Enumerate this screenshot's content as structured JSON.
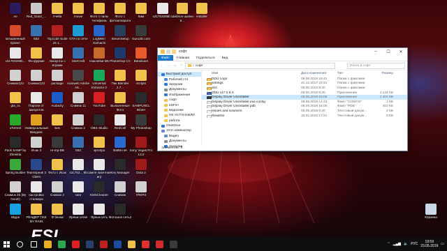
{
  "desktop_icons": [
    {
      "label": "Ae",
      "color": "#2b1a5c"
    },
    {
      "label": "Red_Giant_...",
      "color": "#c8c8c8"
    },
    {
      "label": "Учеба",
      "color": "#f0c24b"
    },
    {
      "label": "movie",
      "color": "#f0c24b"
    },
    {
      "label": "Фото с папы телефона",
      "color": "#f0c24b"
    },
    {
      "label": "Фото с фотоаппарата",
      "color": "#f0c24b"
    },
    {
      "label": "Ким",
      "color": "#f0c24b"
    },
    {
      "label": "x31753285b...",
      "color": "#e8e8e8"
    },
    {
      "label": "Шаблон шапки в...",
      "color": "#f0c24b"
    },
    {
      "label": "installer",
      "color": "#f0c24b"
    },
    {
      "label": "Безымянный проект",
      "color": "#d84a2a"
    },
    {
      "label": "553",
      "color": "#3a6fb0"
    },
    {
      "label": "Topcode Suite 15.1...",
      "color": "#b42020"
    },
    {
      "label": "GTA по сети",
      "color": "#1f9ad6"
    },
    {
      "label": "LogMeIn Hamachi",
      "color": "#2566c8"
    },
    {
      "label": "SteamSetup",
      "color": "#2a3f5c"
    },
    {
      "label": "Guru3D.com",
      "color": "#3a3a3a"
    },
    {
      "label": "x31753286b...",
      "color": "#e8e8e8"
    },
    {
      "label": "Фо-фуркие",
      "color": "#f0c24b"
    },
    {
      "label": "Аккаунты с играми",
      "color": "#e8e8e8"
    },
    {
      "label": "StarCraft",
      "color": "#3a6fb0"
    },
    {
      "label": "Наклейки Ms",
      "color": "#c86a2a"
    },
    {
      "label": "Photoshop CC",
      "color": "#1c3b6b"
    },
    {
      "label": "Bandicam",
      "color": "#e85a2a"
    },
    {
      "label": "Снимок123",
      "color": "#d0d0d0"
    },
    {
      "label": "Снимок123",
      "color": "#d0d0d0"
    },
    {
      "label": "package",
      "color": "#d0d0d0"
    },
    {
      "label": "Autoweb Adobe AE...",
      "color": "#4a4a4a"
    },
    {
      "label": "Universal Extractor 2",
      "color": "#1aa85a"
    },
    {
      "label": "Пак Blender 2.7...",
      "color": "#f0c24b"
    },
    {
      "label": "Scripts",
      "color": "#f0c24b"
    },
    {
      "label": "gta_ra",
      "color": "#f0c24b"
    },
    {
      "label": "Пароли от аккаунтов",
      "color": "#e8e8e8"
    },
    {
      "label": "Audacity",
      "color": "#1c5cc8"
    },
    {
      "label": "Снимок 11",
      "color": "#d0d0d0"
    },
    {
      "label": "YouTube",
      "color": "#d82020"
    },
    {
      "label": "Выпаленные Фото",
      "color": "#f0c24b"
    },
    {
      "label": "SAMPUNCL 5Dver",
      "color": "#2a2a2a"
    },
    {
      "label": "uTorrent",
      "color": "#2aa82a"
    },
    {
      "label": "Универсальный Виндовс",
      "color": "#e0a020"
    },
    {
      "label": "Бек",
      "color": "#f0c24b"
    },
    {
      "label": "Снимок 2",
      "color": "#d0d0d0"
    },
    {
      "label": "OBS Studio",
      "color": "#2a2a2a"
    },
    {
      "label": "RedCell",
      "color": "#e8e8e8"
    },
    {
      "label": "My Photoshop",
      "color": "#3a3a3a"
    },
    {
      "label": "Pack SAMP by Zheekla",
      "color": "#2a2a2a"
    },
    {
      "label": "Исак 3",
      "color": "#d0d0d0"
    },
    {
      "label": "re-mp-BB",
      "color": "#3a3a3a"
    },
    {
      "label": "553",
      "color": "#3a6fb0"
    },
    {
      "label": "эргопро",
      "color": "#f0c24b"
    },
    {
      "label": "Battle.net",
      "color": "#2a6ad0"
    },
    {
      "label": "Sony Vegas Pro 13.0",
      "color": "#a01a1a"
    },
    {
      "label": "Spring Builder",
      "color": "#3aa83a"
    },
    {
      "label": "TeamSpeak 3 Client",
      "color": "#2a4a8a"
    },
    {
      "label": "Фото с Исак",
      "color": "#f0c24b"
    },
    {
      "label": "x31753... 9b",
      "color": "#e8e8e8"
    },
    {
      "label": "сампе пакетная игр",
      "color": "#e8e8e8"
    },
    {
      "label": "Key Manager",
      "color": "#2a2a2a"
    },
    {
      "label": "Dota 2",
      "color": "#a01a1a"
    },
    {
      "label": "Снимок 25 (By GooD)",
      "color": "#d0d0d0"
    },
    {
      "label": "настройки сталкера",
      "color": "#e8e8e8"
    },
    {
      "label": "Снимок 2",
      "color": "#d0d0d0"
    },
    {
      "label": "sara",
      "color": "#e8e8e8"
    },
    {
      "label": "KMSCleaner",
      "color": "#2a2a2a"
    },
    {
      "label": "Снимок",
      "color": "#d0d0d0"
    },
    {
      "label": "!ПК!РЗ",
      "color": "#d0d0d0"
    },
    {
      "label": "Skype",
      "color": "#1aa0e0"
    },
    {
      "label": "РЕНДЕР ПАК BY RAIN",
      "color": "#f0c24b"
    },
    {
      "label": "Ф блоки",
      "color": "#f0c24b"
    },
    {
      "label": "Ярлык сетке",
      "color": "#e8e8e8"
    },
    {
      "label": "Ярлык сеть",
      "color": "#e8e8e8"
    },
    {
      "label": "Фотошоп сеть2",
      "color": "#2a2a2a"
    },
    {
      "label": "Корзина",
      "color": "#c8d8e8"
    }
  ],
  "explorer": {
    "title": "софт",
    "ribbon_tabs": {
      "file": "Файл",
      "home": "Главная",
      "share": "Поделиться",
      "view": "Вид"
    },
    "address_arrow": "›",
    "address": "софт",
    "search_placeholder": "Поиск в софт",
    "nav": [
      {
        "label": "Быстрый доступ",
        "sub": false,
        "sel": true,
        "color": "#2f7bd6"
      },
      {
        "label": "Рабочий сто",
        "sub": true,
        "sel": false,
        "color": "#4a8ad0"
      },
      {
        "label": "Загрузки",
        "sub": true,
        "sel": false,
        "color": "#2f7bd6"
      },
      {
        "label": "Документы",
        "sub": true,
        "sel": false,
        "color": "#8a8a8a"
      },
      {
        "label": "Изображения",
        "sub": true,
        "sel": false,
        "color": "#3a7ac8"
      },
      {
        "label": "софт",
        "sub": true,
        "sel": false,
        "color": "#f0c24b"
      },
      {
        "label": "eSFX+",
        "sub": true,
        "sel": false,
        "color": "#f0c24b"
      },
      {
        "label": "видосики",
        "sub": true,
        "sel": false,
        "color": "#f0c24b"
      },
      {
        "label": "НЕ УСТАНАВЛИ",
        "sub": true,
        "sel": false,
        "color": "#f0c24b"
      },
      {
        "label": "работа",
        "sub": true,
        "sel": false,
        "color": "#f0c24b"
      },
      {
        "label": "OneDrive",
        "sub": false,
        "sel": false,
        "color": "#2f7bd6"
      },
      {
        "label": "Этот компьютер",
        "sub": false,
        "sel": false,
        "color": "#5a8ac8"
      },
      {
        "label": "Видео",
        "sub": true,
        "sel": false,
        "color": "#5a8ac8"
      },
      {
        "label": "Документы",
        "sub": true,
        "sel": false,
        "color": "#8a8a8a"
      },
      {
        "label": "Загрузки",
        "sub": true,
        "sel": false,
        "color": "#2f7bd6"
      }
    ],
    "columns": {
      "name": "Имя",
      "date": "Дата изменения",
      "type": "Тип",
      "size": "Размер"
    },
    "files": [
      {
        "name": "DDU Logs",
        "date": "05.06.2019 18:41",
        "type": "Папка с файлами",
        "size": "",
        "color": "#f0c24b",
        "sel": false
      },
      {
        "name": "settings",
        "date": "21.12.2017 23:41",
        "type": "Папка с файлами",
        "size": "",
        "color": "#f0c24b",
        "sel": false
      },
      {
        "name": "x64",
        "date": "05.05.2019 8:20",
        "type": "Папка с файлами",
        "size": "",
        "color": "#f0c24b",
        "sel": false
      },
      {
        "name": "DDU v17.0.6.4",
        "date": "05.05.2019 8:20",
        "type": "Приложение",
        "size": "1 144 КБ",
        "color": "#4a6ab0",
        "sel": false
      },
      {
        "name": "Display Driver Uninstaller",
        "date": "05.05.2019 16:06",
        "type": "Приложение",
        "size": "1 401 КБ",
        "color": "#3a3a3a",
        "sel": true
      },
      {
        "name": "Display Driver Uninstaller.exe.config",
        "date": "28.05.2019 14:23",
        "type": "Файл \"CONFIG\"",
        "size": "1 КБ",
        "color": "#e8e8e8",
        "sel": false
      },
      {
        "name": "Display Driver Uninstaller.pdb",
        "date": "05.05.2019 16:05",
        "type": "Файл \"PDB\"",
        "size": "402 КБ",
        "color": "#e8e8e8",
        "sel": false
      },
      {
        "name": "Issues and solutions",
        "date": "05.05.2019 8:20",
        "type": "Текстовый докум...",
        "size": "2 КБ",
        "color": "#f2f2f2",
        "sel": false
      },
      {
        "name": "Readme",
        "date": "15.01.2016 17:21",
        "type": "Текстовый докум...",
        "size": "3 КБ",
        "color": "#f2f2f2",
        "sel": false
      }
    ],
    "status": "Элементов: 9"
  },
  "taskbar": {
    "apps": [
      {
        "name": "search",
        "color": "#ffffff"
      },
      {
        "name": "task-view",
        "color": "#ffffff"
      },
      {
        "name": "yandex",
        "color": "#e8b020"
      },
      {
        "name": "chrome",
        "color": "#2aa84a"
      },
      {
        "name": "opera",
        "color": "#e02020"
      },
      {
        "name": "steam",
        "color": "#2a3f6c"
      },
      {
        "name": "vegas",
        "color": "#c02020"
      },
      {
        "name": "photoshop",
        "color": "#1c4ba0"
      },
      {
        "name": "explorer",
        "color": "#f0c24b"
      },
      {
        "name": "yandex-browser",
        "color": "#e03030"
      },
      {
        "name": "app-red",
        "color": "#d02a2a"
      },
      {
        "name": "app-dark",
        "color": "#3a3a3a"
      }
    ],
    "lang": "РУС",
    "time": "19:59",
    "date": "23.05.2019"
  },
  "watermark": "ESL"
}
